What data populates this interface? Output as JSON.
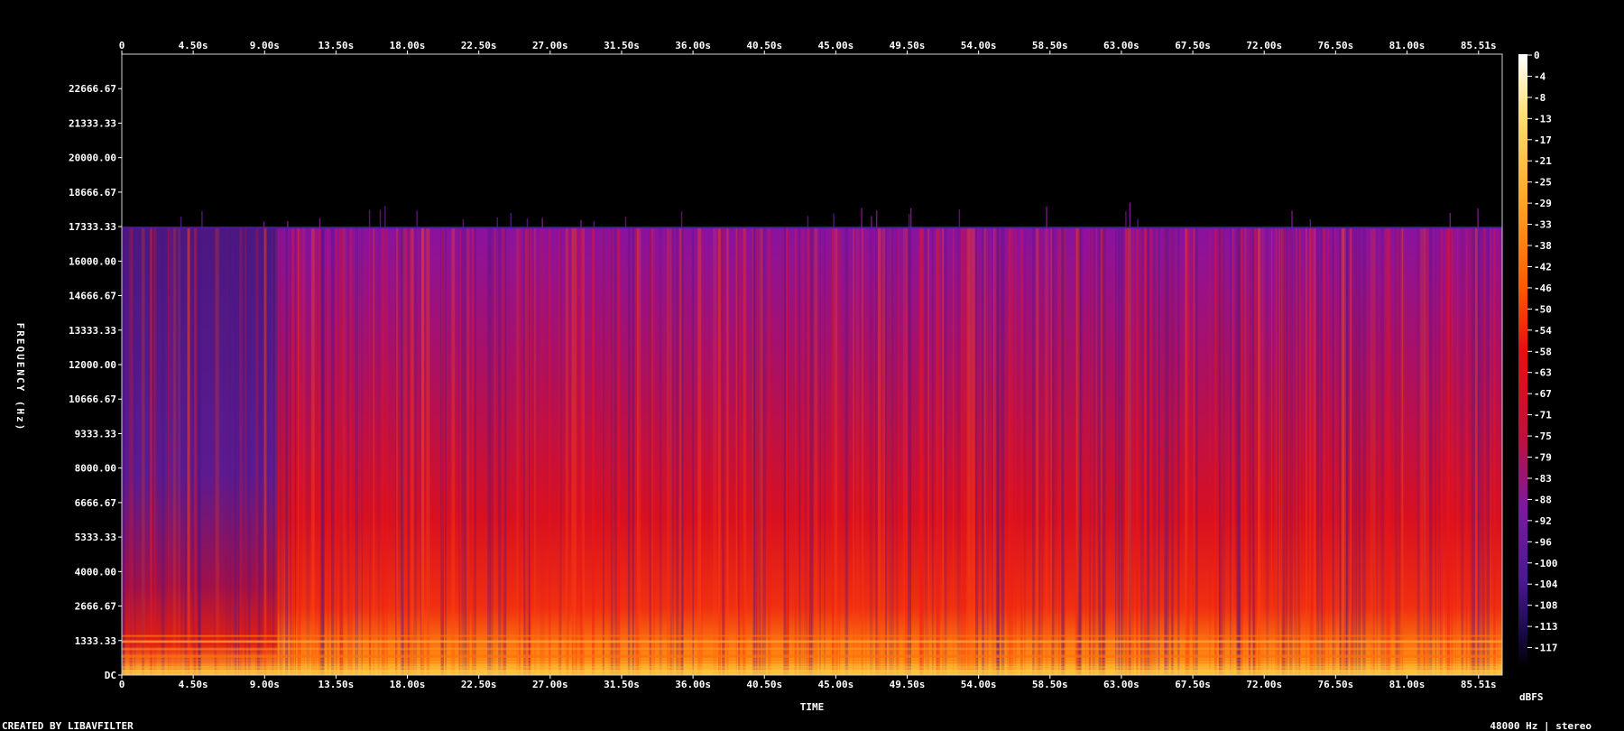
{
  "chart_data": {
    "type": "heatmap",
    "title": "",
    "xlabel": "TIME",
    "ylabel": "FREQUENCY (Hz)",
    "colorbar_label": "dBFS",
    "xlim": [
      0,
      87
    ],
    "ylim": [
      0,
      24000
    ],
    "x_ticks": [
      "0",
      "4.50s",
      "9.00s",
      "13.50s",
      "18.00s",
      "22.50s",
      "27.00s",
      "31.50s",
      "36.00s",
      "40.50s",
      "45.00s",
      "49.50s",
      "54.00s",
      "58.50s",
      "63.00s",
      "67.50s",
      "72.00s",
      "76.50s",
      "81.00s",
      "85.51s"
    ],
    "x_tick_values": [
      0,
      4.5,
      9.0,
      13.5,
      18.0,
      22.5,
      27.0,
      31.5,
      36.0,
      40.5,
      45.0,
      49.5,
      54.0,
      58.5,
      63.0,
      67.5,
      72.0,
      76.5,
      81.0,
      85.51
    ],
    "y_ticks": [
      "DC",
      "1333.33",
      "2666.67",
      "4000.00",
      "5333.33",
      "6666.67",
      "8000.00",
      "9333.33",
      "10666.67",
      "12000.00",
      "13333.33",
      "14666.67",
      "16000.00",
      "17333.33",
      "18666.67",
      "20000.00",
      "21333.33",
      "22666.67"
    ],
    "y_tick_values": [
      0,
      1333.33,
      2666.67,
      4000,
      5333.33,
      6666.67,
      8000,
      9333.33,
      10666.67,
      12000,
      13333.33,
      14666.67,
      16000,
      17333.33,
      18666.67,
      20000,
      21333.33,
      22666.67
    ],
    "colorbar_ticks": [
      "0",
      "-4",
      "-8",
      "-13",
      "-17",
      "-21",
      "-25",
      "-29",
      "-33",
      "-38",
      "-42",
      "-46",
      "-50",
      "-54",
      "-58",
      "-63",
      "-67",
      "-71",
      "-75",
      "-79",
      "-83",
      "-88",
      "-92",
      "-96",
      "-100",
      "-104",
      "-108",
      "-113",
      "-117"
    ],
    "colorbar_range": [
      -120,
      0
    ],
    "content_cutoff_hz": 17300,
    "colormap": [
      "#000000",
      "#1a0a4a",
      "#4a1890",
      "#7a1aa0",
      "#c0103a",
      "#e81010",
      "#ff5a00",
      "#ffa020",
      "#ffe070",
      "#ffffff"
    ],
    "quiet_segment_end_s": 9.8
  },
  "footer": {
    "left": "CREATED BY LIBAVFILTER",
    "right": "48000 Hz | stereo"
  }
}
